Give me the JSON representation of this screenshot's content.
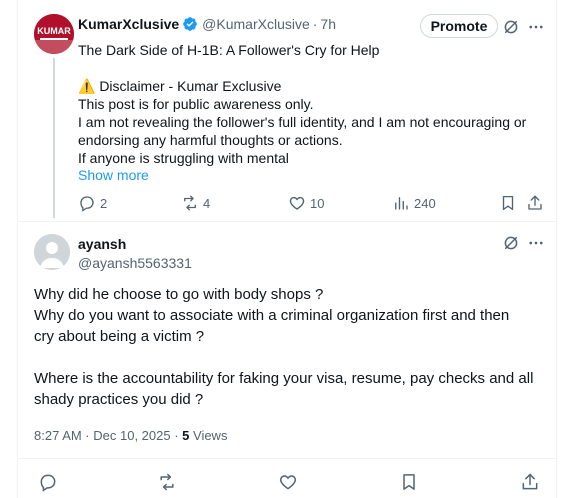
{
  "parent_post": {
    "author_name": "KumarXclusive",
    "avatar_text": "KUMAR",
    "handle": "@KumarXclusive",
    "separator": "·",
    "time": "7h",
    "promote_label": "Promote",
    "title_line": "The Dark Side of H-1B: A Follower's Cry for Help",
    "disclaimer_line": "⚠️ Disclaimer - Kumar Exclusive",
    "line_1": "This post is for public awareness only.",
    "line_2": "I am not revealing the follower's full identity, and I am not encouraging or",
    "line_3": "endorsing any harmful thoughts or actions.",
    "line_4": "If anyone is struggling with mental",
    "show_more_label": "Show more",
    "replies": "2",
    "reposts": "4",
    "likes": "10",
    "views": "240"
  },
  "reply": {
    "author_name": "ayansh",
    "handle": "@ayansh5563331",
    "line_1": "Why did he choose to go with body shops ?",
    "line_2": "Why do you want to associate with a criminal organization first and then",
    "line_3": "cry about being a victim ?",
    "line_4": "Where is the accountability for faking your visa, resume, pay checks and all",
    "line_5": "shady practices you did ?",
    "timestamp": "8:27 AM · Dec 10, 2025",
    "meta_separator": " · ",
    "views_count": "5",
    "views_label": " Views"
  },
  "colors": {
    "text_primary": "#0f1419",
    "text_secondary": "#536471",
    "link": "#1d9bf0",
    "verified": "#1d9bf0",
    "border": "#eff3f4"
  }
}
